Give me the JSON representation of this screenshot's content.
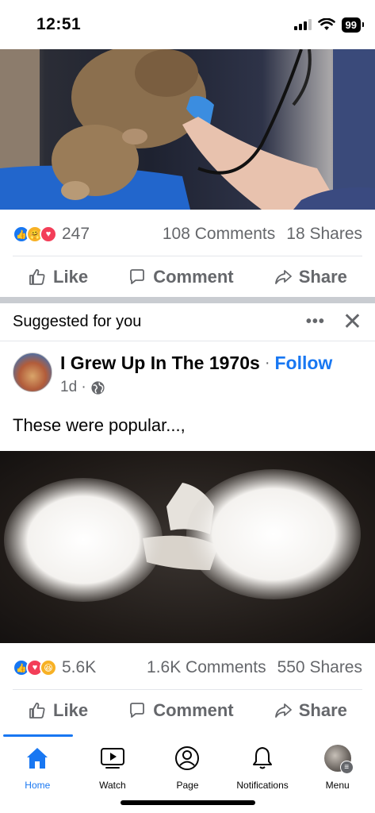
{
  "status_bar": {
    "time": "12:51",
    "battery": "99"
  },
  "post1": {
    "reaction_count": "247",
    "comments": "108 Comments",
    "shares": "18 Shares",
    "reaction_icons": [
      "like",
      "care",
      "love"
    ]
  },
  "post2": {
    "suggested_label": "Suggested for you",
    "page_name": "I Grew Up In The 1970s",
    "separator": "·",
    "follow": "Follow",
    "time": "1d ·",
    "text": "These were popular...,",
    "reaction_count": "5.6K",
    "comments": "1.6K Comments",
    "shares": "550 Shares",
    "reaction_icons": [
      "like",
      "love",
      "haha"
    ]
  },
  "actions": {
    "like": "Like",
    "comment": "Comment",
    "share": "Share"
  },
  "nav": {
    "home": "Home",
    "watch": "Watch",
    "page": "Page",
    "notifications": "Notifications",
    "menu": "Menu"
  },
  "colors": {
    "accent": "#1877f2",
    "muted": "#65676b",
    "separator": "#c9ccd1"
  }
}
